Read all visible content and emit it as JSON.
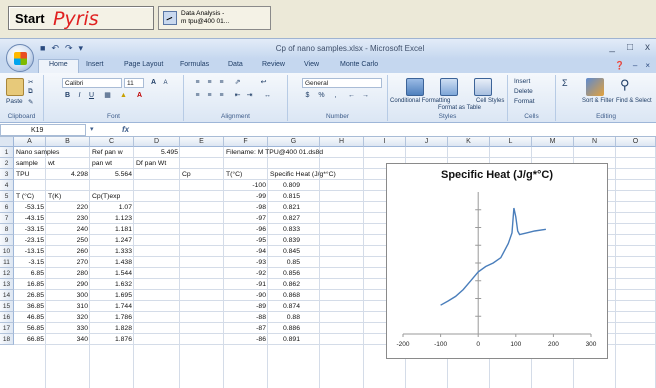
{
  "taskbar": {
    "start_label": "Start",
    "pyris_label": "Pyris",
    "task_line1": "Data Analysis -",
    "task_line2": "m tpu@400 01..."
  },
  "window": {
    "title": "Cp of nano samples.xlsx - Microsoft Excel",
    "min": "_",
    "max": "□",
    "close": "x"
  },
  "tabs": [
    "Home",
    "Insert",
    "Page Layout",
    "Formulas",
    "Data",
    "Review",
    "View",
    "Monte Carlo"
  ],
  "ribbon": {
    "paste": "Paste",
    "font_name": "Calibri",
    "font_size": "11",
    "number_format": "General",
    "groups": [
      "Clipboard",
      "Font",
      "Alignment",
      "Number",
      "Styles",
      "Cells",
      "Editing"
    ],
    "conditional": "Conditional Formatting",
    "format_table": "Format as Table",
    "cell_styles": "Cell Styles",
    "insert": "Insert",
    "delete": "Delete",
    "format": "Format",
    "sort": "Sort & Filter",
    "find": "Find & Select"
  },
  "formula_bar": {
    "name_box": "K19",
    "fx": "fx"
  },
  "columns": [
    "A",
    "B",
    "C",
    "D",
    "E",
    "F",
    "G",
    "H",
    "I",
    "J",
    "K",
    "L",
    "M",
    "N",
    "O"
  ],
  "rows": [
    "1",
    "2",
    "3",
    "4",
    "5",
    "6",
    "7",
    "8",
    "9",
    "10",
    "11",
    "12",
    "13",
    "14",
    "15",
    "16",
    "17",
    "18"
  ],
  "cells": {
    "r1": {
      "a": "Nano samples",
      "c": "Ref pan w",
      "d": "5.495",
      "f": "Filename: M TPU@400 01.ds8d"
    },
    "r2": {
      "a": "sample",
      "b": "wt",
      "c": "pan wt",
      "d": "Df pan Wt"
    },
    "r3": {
      "a": "TPU",
      "b": "4.298",
      "c": "5.564",
      "e": "Cp",
      "f": "T(°C)",
      "g": "Specific Heat (J/g*°C)"
    },
    "r5": {
      "a": "T (°C)",
      "b": "T(K)",
      "c": "Cp(T)exp"
    }
  },
  "table_left": [
    [
      "-53.15",
      "220",
      "1.07"
    ],
    [
      "-43.15",
      "230",
      "1.123"
    ],
    [
      "-33.15",
      "240",
      "1.181"
    ],
    [
      "-23.15",
      "250",
      "1.247"
    ],
    [
      "-13.15",
      "260",
      "1.333"
    ],
    [
      "-3.15",
      "270",
      "1.438"
    ],
    [
      "6.85",
      "280",
      "1.544"
    ],
    [
      "16.85",
      "290",
      "1.632"
    ],
    [
      "26.85",
      "300",
      "1.695"
    ],
    [
      "36.85",
      "310",
      "1.744"
    ],
    [
      "46.85",
      "320",
      "1.786"
    ],
    [
      "56.85",
      "330",
      "1.828"
    ],
    [
      "66.85",
      "340",
      "1.876"
    ]
  ],
  "table_right": [
    [
      "-100",
      "0.809"
    ],
    [
      "-99",
      "0.815"
    ],
    [
      "-98",
      "0.821"
    ],
    [
      "-97",
      "0.827"
    ],
    [
      "-96",
      "0.833"
    ],
    [
      "-95",
      "0.839"
    ],
    [
      "-94",
      "0.845"
    ],
    [
      "-93",
      "0.85"
    ],
    [
      "-92",
      "0.856"
    ],
    [
      "-91",
      "0.862"
    ],
    [
      "-90",
      "0.868"
    ],
    [
      "-89",
      "0.874"
    ],
    [
      "-88",
      "0.88"
    ],
    [
      "-87",
      "0.886"
    ],
    [
      "-86",
      "0.891"
    ]
  ],
  "chart_data": {
    "type": "line",
    "title": "Specific Heat (J/g*°C)",
    "xlabel": "",
    "ylabel": "",
    "xlim": [
      -200,
      300
    ],
    "ylim": [
      0,
      4
    ],
    "x_ticks": [
      "-200",
      "-100",
      "0",
      "100",
      "200",
      "300"
    ],
    "y_ticks": [
      0.5,
      1,
      1.5,
      2,
      2.5,
      3,
      3.5
    ],
    "grid": false,
    "series": [
      {
        "color": "#4a7ebb",
        "x": [
          -100,
          -80,
          -60,
          -40,
          -20,
          0,
          20,
          40,
          60,
          80,
          90,
          95,
          100,
          105,
          110,
          130,
          150,
          180
        ],
        "y": [
          0.81,
          0.93,
          1.06,
          1.25,
          1.5,
          1.75,
          1.9,
          2.0,
          2.15,
          2.55,
          2.85,
          3.55,
          3.3,
          2.9,
          2.8,
          2.85,
          2.9,
          2.95
        ]
      }
    ]
  }
}
